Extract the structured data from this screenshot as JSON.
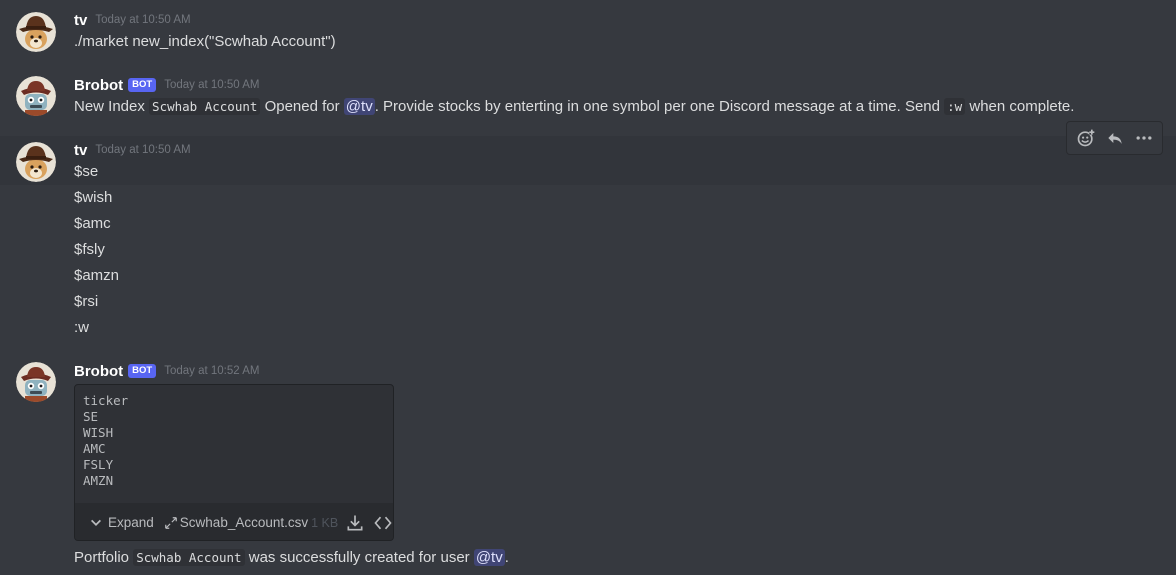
{
  "messages": [
    {
      "author": "tv",
      "timestamp": "Today at 10:50 AM",
      "text": "./market new_index(\"Scwhab Account\")"
    },
    {
      "author": "Brobot",
      "bot_tag": "BOT",
      "timestamp": "Today at 10:50 AM",
      "segments": {
        "t1": "New Index ",
        "code1": "Scwhab Account",
        "t2": " Opened for ",
        "mention": "@tv",
        "t3": ". Provide stocks by enterting in one symbol per one Discord message at a time. Send ",
        "code2": ":w",
        "t4": " when complete."
      }
    },
    {
      "author": "tv",
      "timestamp": "Today at 10:50 AM",
      "lines": [
        "$se",
        "$wish",
        "$amc",
        "$fsly",
        "$amzn",
        "$rsi",
        ":w"
      ]
    },
    {
      "author": "Brobot",
      "bot_tag": "BOT",
      "timestamp": "Today at 10:52 AM",
      "attachment": {
        "preview_lines": [
          "ticker",
          "SE",
          "WISH",
          "AMC",
          "FSLY",
          "AMZN"
        ],
        "expand_label": "Expand",
        "filename": "Scwhab_Account.csv",
        "size": "1 KB"
      },
      "segments": {
        "t1": "Portfolio ",
        "code1": "Scwhab Account",
        "t2": " was successfully created for user ",
        "mention": "@tv",
        "t3": "."
      }
    }
  ],
  "toolbar": {
    "icons": [
      "add-reaction-icon",
      "reply-icon",
      "more-options-icon"
    ]
  },
  "colors": {
    "background": "#36393f",
    "bot_tag": "#5865f2",
    "mention_bg": "#4a5089",
    "code_bg": "#2f3136",
    "timestamp": "#72767d"
  }
}
